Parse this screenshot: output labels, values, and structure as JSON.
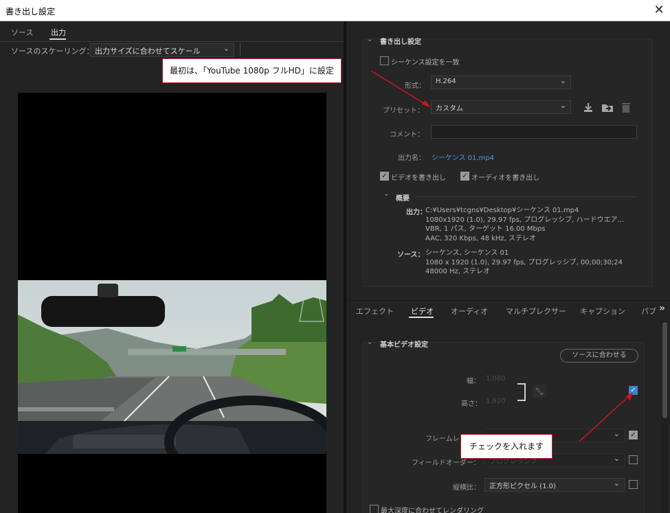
{
  "window": {
    "title": "書き出し設定",
    "close": "✕"
  },
  "left": {
    "tabs": [
      "ソース",
      "出力"
    ],
    "scaling_label": "ソースのスケーリング：",
    "scaling_value": "出力サイズに合わせてスケール"
  },
  "export": {
    "section_title": "書き出し設定",
    "match_sequence": "シーケンス設定を一致",
    "format_label": "形式：",
    "format_value": "H.264",
    "preset_label": "プリセット：",
    "preset_value": "カスタム",
    "comment_label": "コメント：",
    "comment_value": "",
    "output_name_label": "出力名：",
    "output_name_value": "シーケンス 01.mp4",
    "export_video": "ビデオを書き出し",
    "export_audio": "オーディオを書き出し",
    "summary_title": "概要",
    "output_key": "出力：",
    "output_lines": [
      "C:¥Users¥tcgns¥Desktop¥シーケンス 01.mp4",
      "1080x1920 (1.0), 29.97 fps, プログレッシブ, ハードウエア...",
      "VBR, 1 パス, ターゲット 16.00 Mbps",
      "AAC, 320 Kbps, 48 kHz, ステレオ"
    ],
    "source_key": "ソース：",
    "source_lines": [
      "シーケンス, シーケンス 01",
      "1080 x 1920 (1.0), 29.97 fps, プログレッシブ, 00;00;30;24",
      "48000  Hz, ステレオ"
    ]
  },
  "tabs": [
    "エフェクト",
    "ビデオ",
    "オーディオ",
    "マルチプレクサー",
    "キャプション",
    "パブ"
  ],
  "more_tabs_icon": "»",
  "video": {
    "section_title": "基本ビデオ設定",
    "match_source_button": "ソースに合わせる",
    "width_label": "幅：",
    "width_value": "1,080",
    "height_label": "高さ：",
    "height_value": "1,920",
    "frame_rate_label": "フレームレ",
    "field_order_label": "フィールドオーダー：",
    "field_order_value": "プログレッシブ",
    "aspect_label": "縦横比：",
    "aspect_value": "正方形ピクセル (1.0)",
    "max_depth": "最大深度に合わせてレンダリング"
  },
  "callouts": {
    "preset_note": "最初は、「YouTube 1080p フルHD」に設定",
    "check_note": "チェックを入れます"
  },
  "colors": {
    "accent_blue": "#3c84d6",
    "link_blue": "#4a9ad8",
    "callout_red": "#d01818"
  }
}
